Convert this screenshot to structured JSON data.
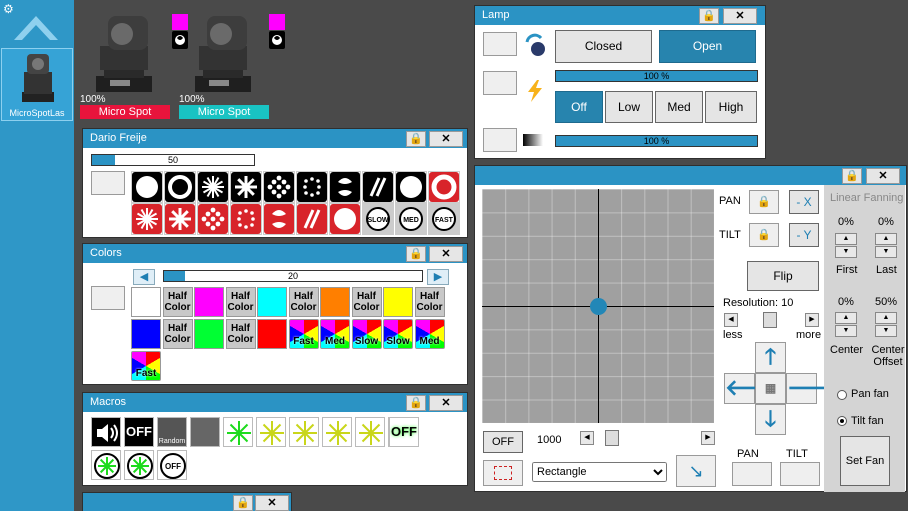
{
  "sidebar": {
    "settings_icon": "gear-icon",
    "logo_icon": "chevron-up-icon",
    "items": [
      {
        "label": "MicroSpotLas"
      }
    ]
  },
  "fixtures": [
    {
      "percent": "100%",
      "name": "Micro Spot",
      "name_color": "#e8143c",
      "swatch_color": "#ff00ff"
    },
    {
      "percent": "100%",
      "name": "Micro Spot",
      "name_color": "#19c3c3",
      "swatch_color": "#ff00ff"
    }
  ],
  "lamp_panel": {
    "title": "Lamp",
    "closed_label": "Closed",
    "open_label": "Open",
    "dimmer_value": "100 %",
    "dimmer_fraction": 1.0,
    "speed_buttons": [
      "Off",
      "Low",
      "Med",
      "High"
    ],
    "speed_active": "Off",
    "shutter_value": "100 %",
    "shutter_fraction": 1.0
  },
  "gobo_panel": {
    "title": "Dario Freije",
    "slider_value": "50",
    "slider_fraction": 0.14,
    "row2_labels": [
      "SLOW",
      "MED",
      "FAST"
    ]
  },
  "colors_panel": {
    "title": "Colors",
    "slider_value": "20",
    "slider_fraction": 0.08,
    "half_label": "Half Color",
    "row1": [
      "#ffffff",
      "half",
      "#ff00ff",
      "half",
      "#00ffff",
      "half",
      "#ff7f00",
      "half",
      "#ffff00",
      "half"
    ],
    "row2": [
      "#0000ff",
      "half",
      "#00ff33",
      "half",
      "#ff0000"
    ],
    "wheels_row2": [
      "Fast",
      "Med",
      "Slow",
      "Slow",
      "Med"
    ],
    "wheels_row3": [
      "Fast"
    ]
  },
  "macros_panel": {
    "title": "Macros",
    "off_label": "OFF",
    "random_label": "Random",
    "off_green_label": "OFF"
  },
  "pantilt_panel": {
    "pan_label": "PAN",
    "tilt_label": "TILT",
    "invert_x": "- X",
    "invert_y": "- Y",
    "flip_label": "Flip",
    "resolution_label": "Resolution: 10",
    "less_label": "less",
    "more_label": "more",
    "off_label": "OFF",
    "speed_value": "1000",
    "shape_value": "Rectangle",
    "pan_btn": "PAN",
    "tilt_btn": "TILT",
    "fanning": {
      "title": "Linear Fanning",
      "first_pct": "0%",
      "last_pct": "0%",
      "first_label": "First",
      "last_label": "Last",
      "center_pct": "0%",
      "offset_pct": "50%",
      "center_label": "Center",
      "offset_label": "Center Offset",
      "pan_fan": "Pan fan",
      "tilt_fan": "Tilt fan",
      "tilt_fan_selected": true,
      "set_fan": "Set Fan"
    }
  }
}
